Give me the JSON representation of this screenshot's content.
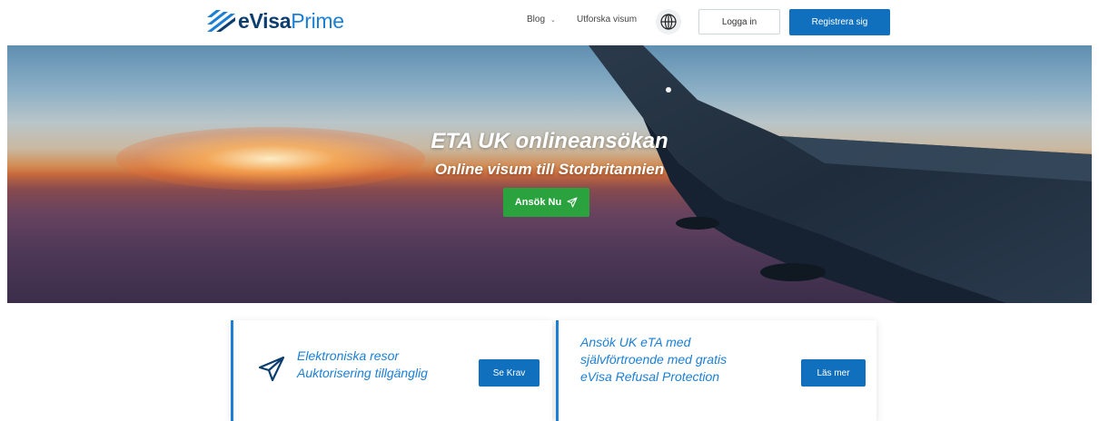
{
  "brand": {
    "part1": "eVisa",
    "part2": "Prime",
    "mark_icon": "stripes-logo-icon"
  },
  "nav": {
    "blog": "Blog",
    "explore": "Utforska visum",
    "language_icon": "globe-icon",
    "login": "Logga in",
    "register": "Registrera sig"
  },
  "hero": {
    "title": "ETA UK onlineansökan",
    "subtitle": "Online visum till Storbritannien",
    "cta": "Ansök Nu"
  },
  "cards": [
    {
      "text": "Elektroniska resor Auktorisering tillgänglig",
      "button": "Se Krav",
      "icon": "paper-plane-icon"
    },
    {
      "text": "Ansök UK eTA med självförtroende med gratis eVisa Refusal Protection",
      "button": "Läs mer"
    }
  ],
  "colors": {
    "primary": "#1170bd",
    "accent": "#1b7fd4",
    "success": "#2aa33e",
    "brand_dark": "#0b3e6f"
  }
}
